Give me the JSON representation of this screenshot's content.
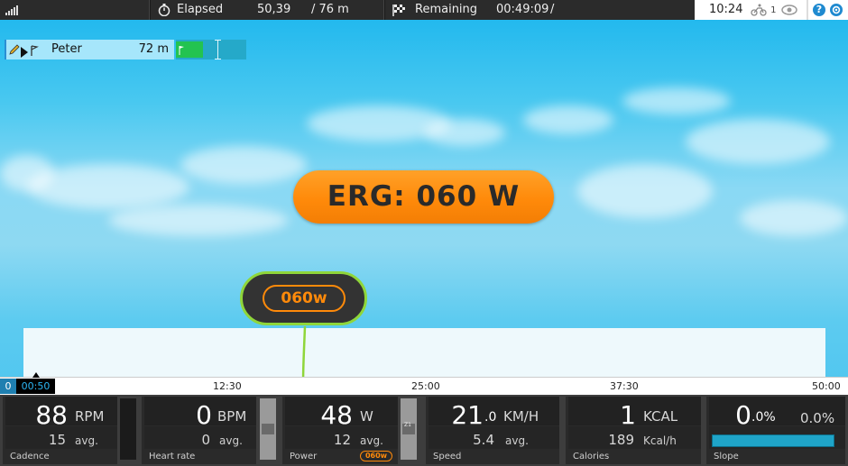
{
  "topbar": {
    "elapsed_label": "Elapsed",
    "elapsed_time": "50,39",
    "elapsed_distance": "/ 76 m",
    "remaining_label": "Remaining",
    "remaining_time": "00:49:09",
    "remaining_sep": "/",
    "clock": "10:24",
    "riders_count": "1",
    "help_icon": "?",
    "settings_icon": "gear"
  },
  "rider": {
    "name": "Peter",
    "distance": "72 m"
  },
  "erg": {
    "label": "ERG: 060 W"
  },
  "bubble": {
    "label": "060w"
  },
  "timeline": {
    "start": "0",
    "current": "00:50",
    "marks": [
      "12:30",
      "25:00",
      "37:30",
      "50:00"
    ]
  },
  "tiles": {
    "cadence": {
      "value": "88",
      "unit": "RPM",
      "avg": "15",
      "avg_label": "avg.",
      "name": "Cadence"
    },
    "heart": {
      "value": "0",
      "unit": "BPM",
      "avg": "0",
      "avg_label": "avg.",
      "name": "Heart rate"
    },
    "power": {
      "value": "48",
      "unit": "W",
      "avg": "12",
      "avg_label": "avg.",
      "name": "Power",
      "target": "060w",
      "zone": "Z1"
    },
    "speed": {
      "value": "21",
      "decimal": ".0",
      "unit": "KM/H",
      "avg": "5.4",
      "avg_label": "avg.",
      "name": "Speed"
    },
    "calories": {
      "value": "1",
      "unit": "KCAL",
      "avg": "189",
      "avg_label": "Kcal/h",
      "name": "Calories"
    },
    "slope": {
      "value": "0",
      "decimal": ".0%",
      "target": "0.0%",
      "name": "Slope"
    }
  },
  "colors": {
    "sky": "#38c6ee",
    "erg_orange": "#ff8a0a",
    "bubble_green": "#8fd63a",
    "slope_blue": "#1fa4c8"
  }
}
